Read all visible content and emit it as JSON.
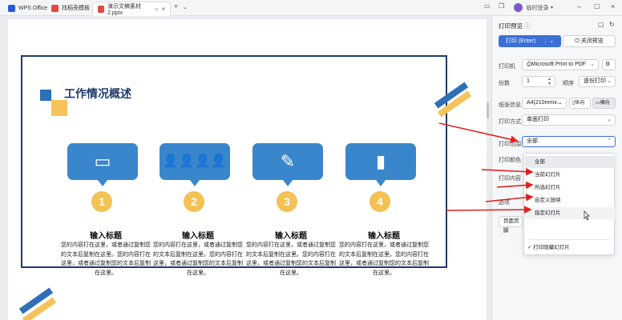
{
  "titlebar": {
    "tabs": [
      {
        "label": "WPS Office"
      },
      {
        "label": "找稻壳模板"
      },
      {
        "label": "演示文稿素材2.pptx"
      }
    ],
    "new_tab": "+",
    "login": "临时登录"
  },
  "slide": {
    "title": "工作情况概述",
    "items": [
      {
        "num": "1",
        "heading": "输入标题",
        "body": "您的内容打在这里，或者通过复制您的文本后复制在这里。您的内容打在这里，或者通过复制您的文本后复制在这里。"
      },
      {
        "num": "2",
        "heading": "输入标题",
        "body": "您的内容打在这里，或者通过复制您的文本后复制在这里。您的内容打在这里，或者通过复制您的文本后复制在这里。"
      },
      {
        "num": "3",
        "heading": "输入标题",
        "body": "您的内容打在这里，或者通过复制您的文本后复制在这里。您的内容打在这里，或者通过复制您的文本后复制在这里。"
      },
      {
        "num": "4",
        "heading": "输入标题",
        "body": "您的内容打在这里，或者通过复制您的文本后复制在这里。您的内容打在这里，或者通过复制您的文本后复制在这里。"
      }
    ]
  },
  "panel": {
    "title": "打印预览",
    "print_button": "打印 (Enter)",
    "close_button": "关闭预览",
    "printer_label": "打印机",
    "printer_value": "Microsoft Print to PDF",
    "copies_label": "份数",
    "copies_value": "1",
    "order_label": "顺序",
    "order_value": "逐份打印",
    "paper_label": "纸张信息",
    "paper_value": "A4(210mmx...",
    "portrait": "纵向",
    "landscape": "横向",
    "mode_label": "打印方式",
    "mode_value": "单面打印",
    "range_label": "打印范围",
    "range_value": "全部",
    "color_label": "打印颜色",
    "content_label": "打印内容",
    "options_label": "选项",
    "page_setup": "页面页脚",
    "dropdown": [
      "全部",
      "当前幻灯片",
      "所选幻灯片",
      "自定义放映",
      "指定幻灯片"
    ],
    "hidden_option": "打印隐藏幻灯片"
  },
  "colors": {
    "accent": "#3b6fd6",
    "navy": "#1e3a6e",
    "card_blue": "#3a86cc",
    "yellow": "#f4c154",
    "arrow_red": "#e02020"
  }
}
